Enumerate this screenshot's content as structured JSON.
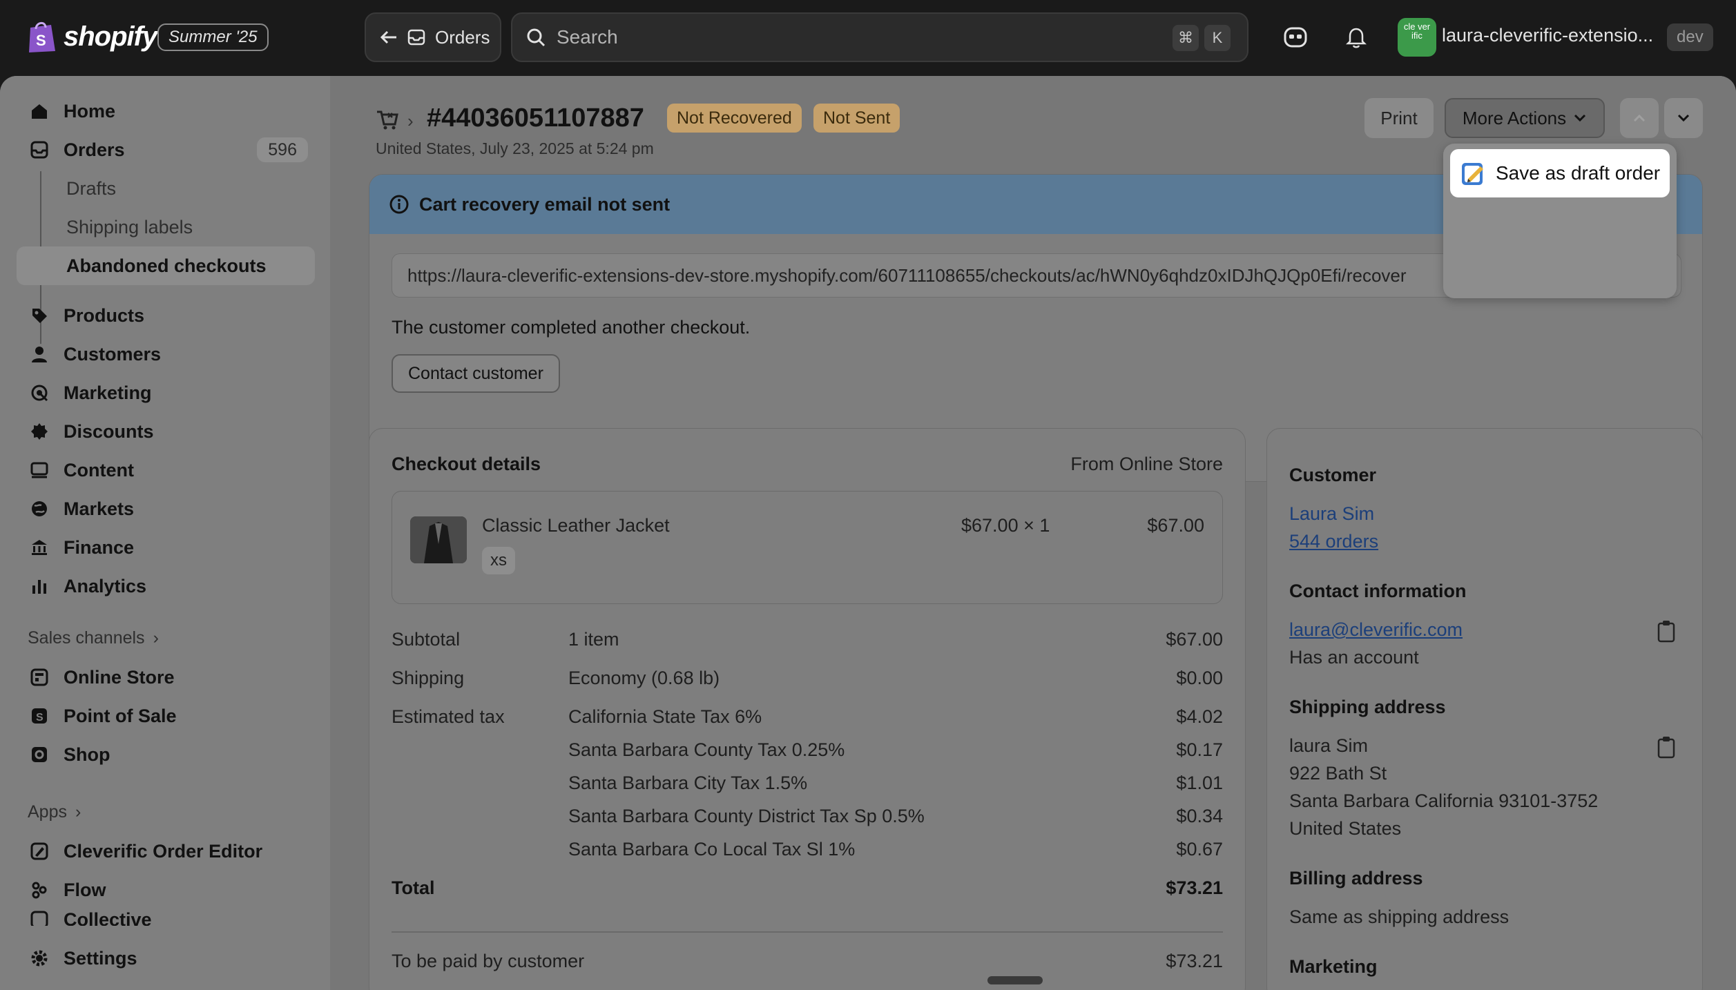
{
  "topbar": {
    "brand": "shopify",
    "edition": "Summer '25",
    "back_label": "Orders",
    "search_placeholder": "Search",
    "shortcut_cmd": "⌘",
    "shortcut_key": "K",
    "store_avatar": "cle ver ific",
    "store_name": "laura-cleverific-extensio...",
    "env_badge": "dev"
  },
  "sidebar": {
    "items": [
      {
        "label": "Home",
        "icon": "home-icon"
      },
      {
        "label": "Orders",
        "icon": "orders-icon",
        "count": "596"
      },
      {
        "label": "Drafts"
      },
      {
        "label": "Shipping labels"
      },
      {
        "label": "Abandoned checkouts"
      },
      {
        "label": "Products",
        "icon": "tag-icon"
      },
      {
        "label": "Customers",
        "icon": "person-icon"
      },
      {
        "label": "Marketing",
        "icon": "target-icon"
      },
      {
        "label": "Discounts",
        "icon": "discount-icon"
      },
      {
        "label": "Content",
        "icon": "content-icon"
      },
      {
        "label": "Markets",
        "icon": "globe-icon"
      },
      {
        "label": "Finance",
        "icon": "bank-icon"
      },
      {
        "label": "Analytics",
        "icon": "bar-chart-icon"
      }
    ],
    "sales_channels_label": "Sales channels",
    "channels": [
      {
        "label": "Online Store",
        "icon": "store-icon"
      },
      {
        "label": "Point of Sale",
        "icon": "pos-icon"
      },
      {
        "label": "Shop",
        "icon": "shop-icon"
      }
    ],
    "apps_label": "Apps",
    "apps": [
      {
        "label": "Cleverific Order Editor",
        "icon": "app-editor-icon"
      },
      {
        "label": "Flow",
        "icon": "flow-icon"
      },
      {
        "label": "Collective",
        "icon": "collective-icon"
      }
    ],
    "settings_label": "Settings"
  },
  "header": {
    "order_number": "#44036051107887",
    "badge_recovered": "Not Recovered",
    "badge_sent": "Not Sent",
    "subtitle": "United States, July 23, 2025 at 5:24 pm",
    "print_label": "Print",
    "more_actions_label": "More Actions"
  },
  "dropdown": {
    "items": [
      {
        "label": "Save as draft order"
      }
    ]
  },
  "recovery": {
    "banner_title": "Cart recovery email not sent",
    "url": "https://laura-cleverific-extensions-dev-store.myshopify.com/60711108655/checkouts/ac/hWN0y6qhdz0xIDJhQJQp0Efi/recover",
    "message": "The customer completed another checkout.",
    "contact_button": "Contact customer"
  },
  "checkout": {
    "title": "Checkout details",
    "source": "From Online Store",
    "line_item": {
      "name": "Classic Leather Jacket",
      "variant": "xs",
      "unit_qty": "$67.00 × 1",
      "total": "$67.00"
    },
    "summary": [
      {
        "label": "Subtotal",
        "detail": "1 item",
        "amount": "$67.00"
      },
      {
        "label": "Shipping",
        "detail": "Economy (0.68 lb)",
        "amount": "$0.00"
      },
      {
        "label": "Estimated tax",
        "detail": "California State Tax 6%",
        "amount": "$4.02"
      },
      {
        "label": "",
        "detail": "Santa Barbara County Tax 0.25%",
        "amount": "$0.17"
      },
      {
        "label": "",
        "detail": "Santa Barbara City Tax 1.5%",
        "amount": "$1.01"
      },
      {
        "label": "",
        "detail": "Santa Barbara County District Tax Sp 0.5%",
        "amount": "$0.34"
      },
      {
        "label": "",
        "detail": "Santa Barbara Co Local Tax Sl 1%",
        "amount": "$0.67"
      }
    ],
    "total_label": "Total",
    "total_amount": "$73.21",
    "to_pay_label": "To be paid by customer",
    "to_pay_amount": "$73.21"
  },
  "customer": {
    "title": "Customer",
    "name": "Laura Sim",
    "orders": "544 orders",
    "contact_title": "Contact information",
    "email": "laura@cleverific.com",
    "account_status": "Has an account",
    "shipping_title": "Shipping address",
    "shipping_lines": [
      "laura Sim",
      "922 Bath St",
      "Santa Barbara California 93101-3752",
      "United States"
    ],
    "billing_title": "Billing address",
    "billing_text": "Same as shipping address",
    "marketing_title": "Marketing"
  }
}
